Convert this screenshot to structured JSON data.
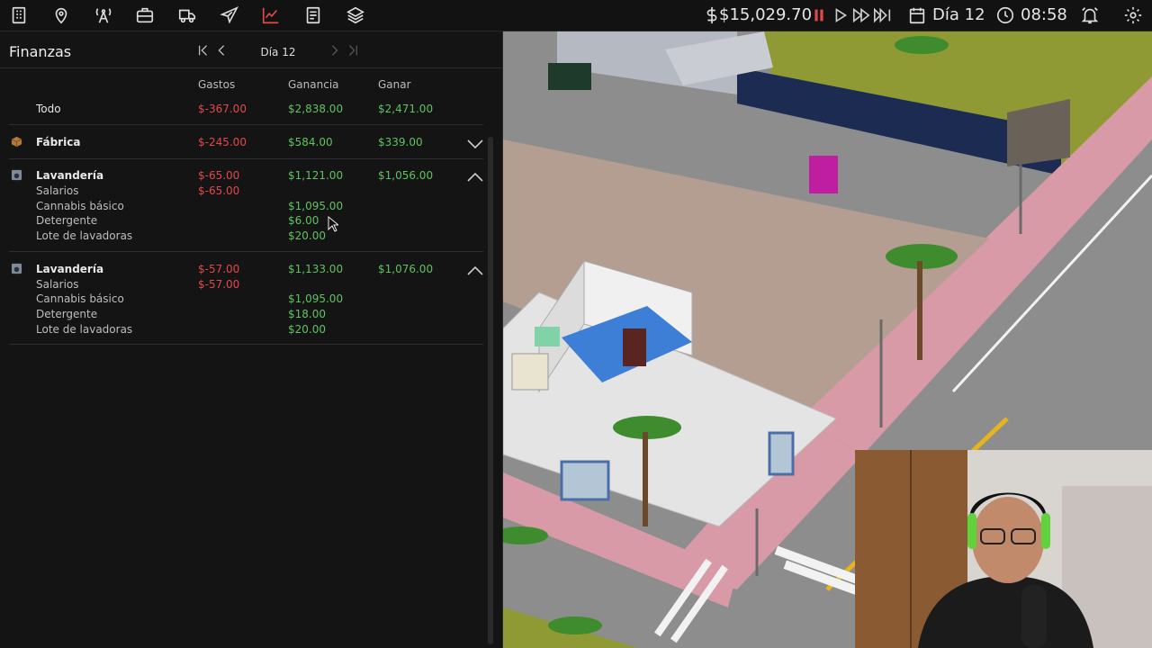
{
  "topbar": {
    "money": "$15,029.70",
    "day": "Día 12",
    "time": "08:58",
    "icons": [
      "building-icon",
      "map-pin-icon",
      "radio-tower-icon",
      "briefcase-icon",
      "delivery-truck-icon",
      "airplane-icon",
      "chart-trend-icon",
      "document-icon",
      "layers-icon",
      "dollar-icon",
      "pause-icon",
      "play-icon",
      "fast-forward-icon",
      "skip-forward-icon",
      "calendar-icon",
      "clock-icon",
      "alarm-bell-icon",
      "gear-icon"
    ]
  },
  "panel": {
    "title": "Finanzas",
    "day_label": "Día 12",
    "columns": [
      "Gastos",
      "Ganancia",
      "Ganar"
    ],
    "total": {
      "label": "Todo",
      "gastos": "$-367.00",
      "ganancia": "$2,838.00",
      "ganar": "$2,471.00"
    },
    "groups": [
      {
        "label": "Fábrica",
        "gastos": "$-245.00",
        "ganancia": "$584.00",
        "ganar": "$339.00",
        "expanded": false,
        "icon": "box-icon",
        "items": []
      },
      {
        "label": "Lavandería",
        "gastos": "$-65.00",
        "ganancia": "$1,121.00",
        "ganar": "$1,056.00",
        "expanded": true,
        "icon": "washing-machine-icon",
        "items": [
          {
            "label": "Salarios",
            "gastos": "$-65.00",
            "ganancia": ""
          },
          {
            "label": "Cannabis básico",
            "gastos": "",
            "ganancia": "$1,095.00"
          },
          {
            "label": "Detergente",
            "gastos": "",
            "ganancia": "$6.00"
          },
          {
            "label": "Lote de lavadoras",
            "gastos": "",
            "ganancia": "$20.00"
          }
        ]
      },
      {
        "label": "Lavandería",
        "gastos": "$-57.00",
        "ganancia": "$1,133.00",
        "ganar": "$1,076.00",
        "expanded": true,
        "icon": "washing-machine-icon",
        "items": [
          {
            "label": "Salarios",
            "gastos": "$-57.00",
            "ganancia": ""
          },
          {
            "label": "Cannabis básico",
            "gastos": "",
            "ganancia": "$1,095.00"
          },
          {
            "label": "Detergente",
            "gastos": "",
            "ganancia": "$18.00"
          },
          {
            "label": "Lote de lavadoras",
            "gastos": "",
            "ganancia": "$20.00"
          }
        ]
      }
    ]
  },
  "colors": {
    "negative": "#e0494b",
    "positive": "#5fc35f",
    "accent_red": "#e0494b",
    "panel_bg": "#141414"
  }
}
